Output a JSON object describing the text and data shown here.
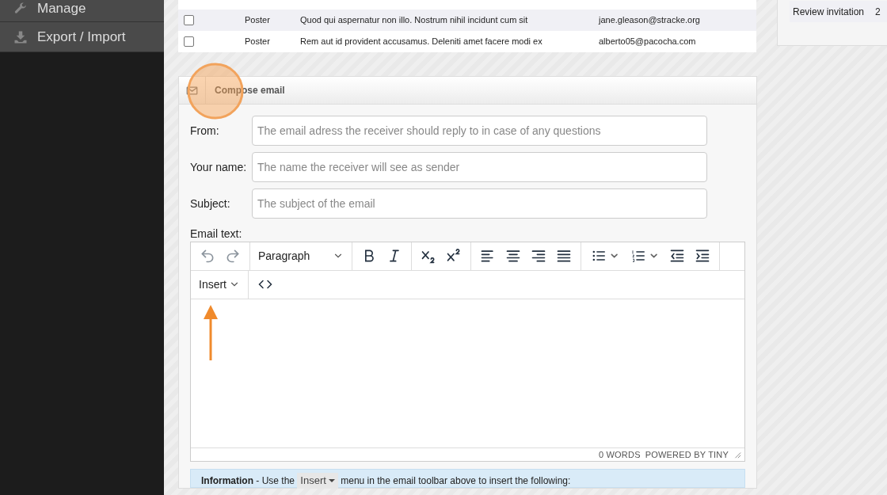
{
  "sidebar": {
    "items": [
      {
        "label": "Manage"
      },
      {
        "label": "Export / Import"
      }
    ]
  },
  "table": {
    "rows": [
      {
        "checked": false,
        "type": "Poster",
        "message": "Quod qui aspernatur non illo. Nostrum nihil incidunt cum sit",
        "email": "jane.gleason@stracke.org"
      },
      {
        "checked": false,
        "type": "Poster",
        "message": "Rem aut id provident accusamus. Deleniti amet facere modi ex",
        "email": "alberto05@pacocha.com"
      }
    ]
  },
  "side_panel": {
    "rows": [
      {
        "label": "Review invitation",
        "value": "2"
      }
    ]
  },
  "compose": {
    "title": "Compose email",
    "fields": [
      {
        "label": "From:",
        "placeholder": "The email adress the receiver should reply to in case of any questions"
      },
      {
        "label": "Your name:",
        "placeholder": "The name the receiver will see as sender"
      },
      {
        "label": "Subject:",
        "placeholder": "The subject of the email"
      }
    ],
    "editor": {
      "label": "Email text:",
      "block_format": "Paragraph",
      "insert_menu": "Insert",
      "word_count": "0 WORDS",
      "branding": "POWERED BY TINY"
    },
    "info": {
      "before": "**Information** - Use the",
      "button": "Insert",
      "after": "menu in the email toolbar above to insert the following:"
    }
  }
}
